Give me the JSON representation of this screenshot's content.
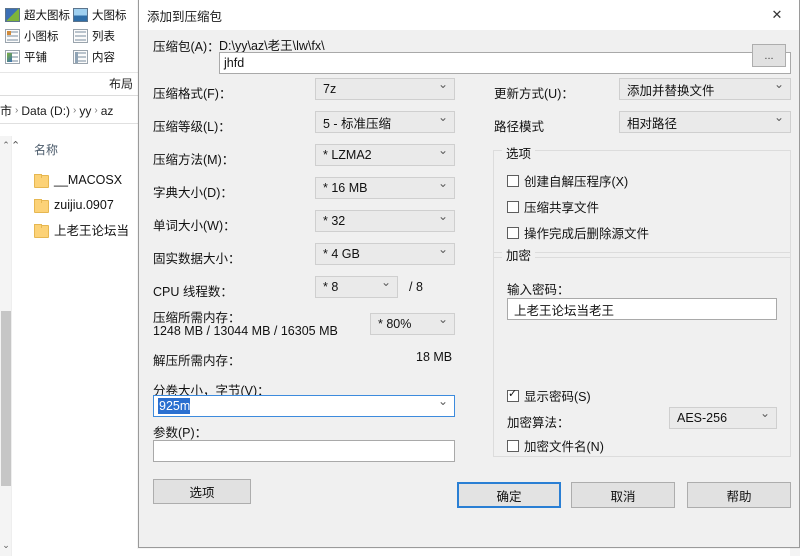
{
  "explorer": {
    "ribbon": {
      "group_label": "布局",
      "items": [
        {
          "label": "超大图标",
          "icon": "extra-large-icons-icon"
        },
        {
          "label": "大图标",
          "icon": "large-icons-icon"
        },
        {
          "label": "小图标",
          "icon": "small-icons-icon"
        },
        {
          "label": "列表",
          "icon": "list-view-icon"
        },
        {
          "label": "平铺",
          "icon": "tiles-view-icon"
        },
        {
          "label": "内容",
          "icon": "content-view-icon"
        }
      ]
    },
    "breadcrumb": [
      "市",
      "Data (D:)",
      "yy",
      "az"
    ],
    "column_header": "名称",
    "files": [
      {
        "name": "__MACOSX",
        "icon": "folder-icon"
      },
      {
        "name": "zuijiu.0907",
        "icon": "folder-icon"
      },
      {
        "name": "上老王论坛当",
        "icon": "folder-icon"
      }
    ]
  },
  "dialog": {
    "title": "添加到压缩包",
    "close_label": "✕",
    "archive": {
      "label": "压缩包(A)：",
      "path": "D:\\yy\\az\\老王\\lw\\fx\\",
      "value": "jhfd",
      "browse_label": "..."
    },
    "left_fields": [
      {
        "label": "压缩格式(F)：",
        "value": "7z",
        "name": "archive-format"
      },
      {
        "label": "压缩等级(L)：",
        "value": "5 - 标准压缩",
        "name": "compression-level"
      },
      {
        "label": "压缩方法(M)：",
        "value": "* LZMA2",
        "name": "compression-method"
      },
      {
        "label": "字典大小(D)：",
        "value": "* 16 MB",
        "name": "dictionary-size"
      },
      {
        "label": "单词大小(W)：",
        "value": "* 32",
        "name": "word-size"
      },
      {
        "label": "固实数据大小：",
        "value": "* 4 GB",
        "name": "solid-block-size"
      }
    ],
    "cpu_threads": {
      "label": "CPU 线程数：",
      "value": "* 8",
      "total": "/ 8"
    },
    "memory_compress": {
      "label": "压缩所需内存：",
      "detail": "1248 MB / 13044 MB / 16305 MB",
      "percent": "* 80%"
    },
    "memory_decompress": {
      "label": "解压所需内存：",
      "value": "18 MB"
    },
    "volume": {
      "label": "分卷大小，字节(V)：",
      "value": "925m"
    },
    "parameters": {
      "label": "参数(P)：",
      "value": ""
    },
    "options_button": "选项",
    "update_mode": {
      "label": "更新方式(U)：",
      "value": "添加并替换文件"
    },
    "path_mode": {
      "label": "路径模式",
      "value": "相对路径"
    },
    "options_group": {
      "title": "选项",
      "checkboxes": [
        {
          "label": "创建自解压程序(X)",
          "checked": false,
          "name": "create-sfx-checkbox"
        },
        {
          "label": "压缩共享文件",
          "checked": false,
          "name": "compress-shared-files-checkbox"
        },
        {
          "label": "操作完成后删除源文件",
          "checked": false,
          "name": "delete-after-compress-checkbox"
        }
      ]
    },
    "encryption_group": {
      "title": "加密",
      "password_label": "输入密码：",
      "password_value": "上老王论坛当老王",
      "show_password": {
        "label": "显示密码(S)",
        "checked": true
      },
      "algorithm_label": "加密算法：",
      "algorithm_value": "AES-256",
      "encrypt_names": {
        "label": "加密文件名(N)",
        "checked": false
      }
    },
    "buttons": {
      "ok": "确定",
      "cancel": "取消",
      "help": "帮助"
    }
  },
  "colors": {
    "dialog_bg": "#f0f0f0",
    "accent": "#2a7fd4",
    "selection": "#2a6fd0",
    "folder": "#fcd277"
  }
}
